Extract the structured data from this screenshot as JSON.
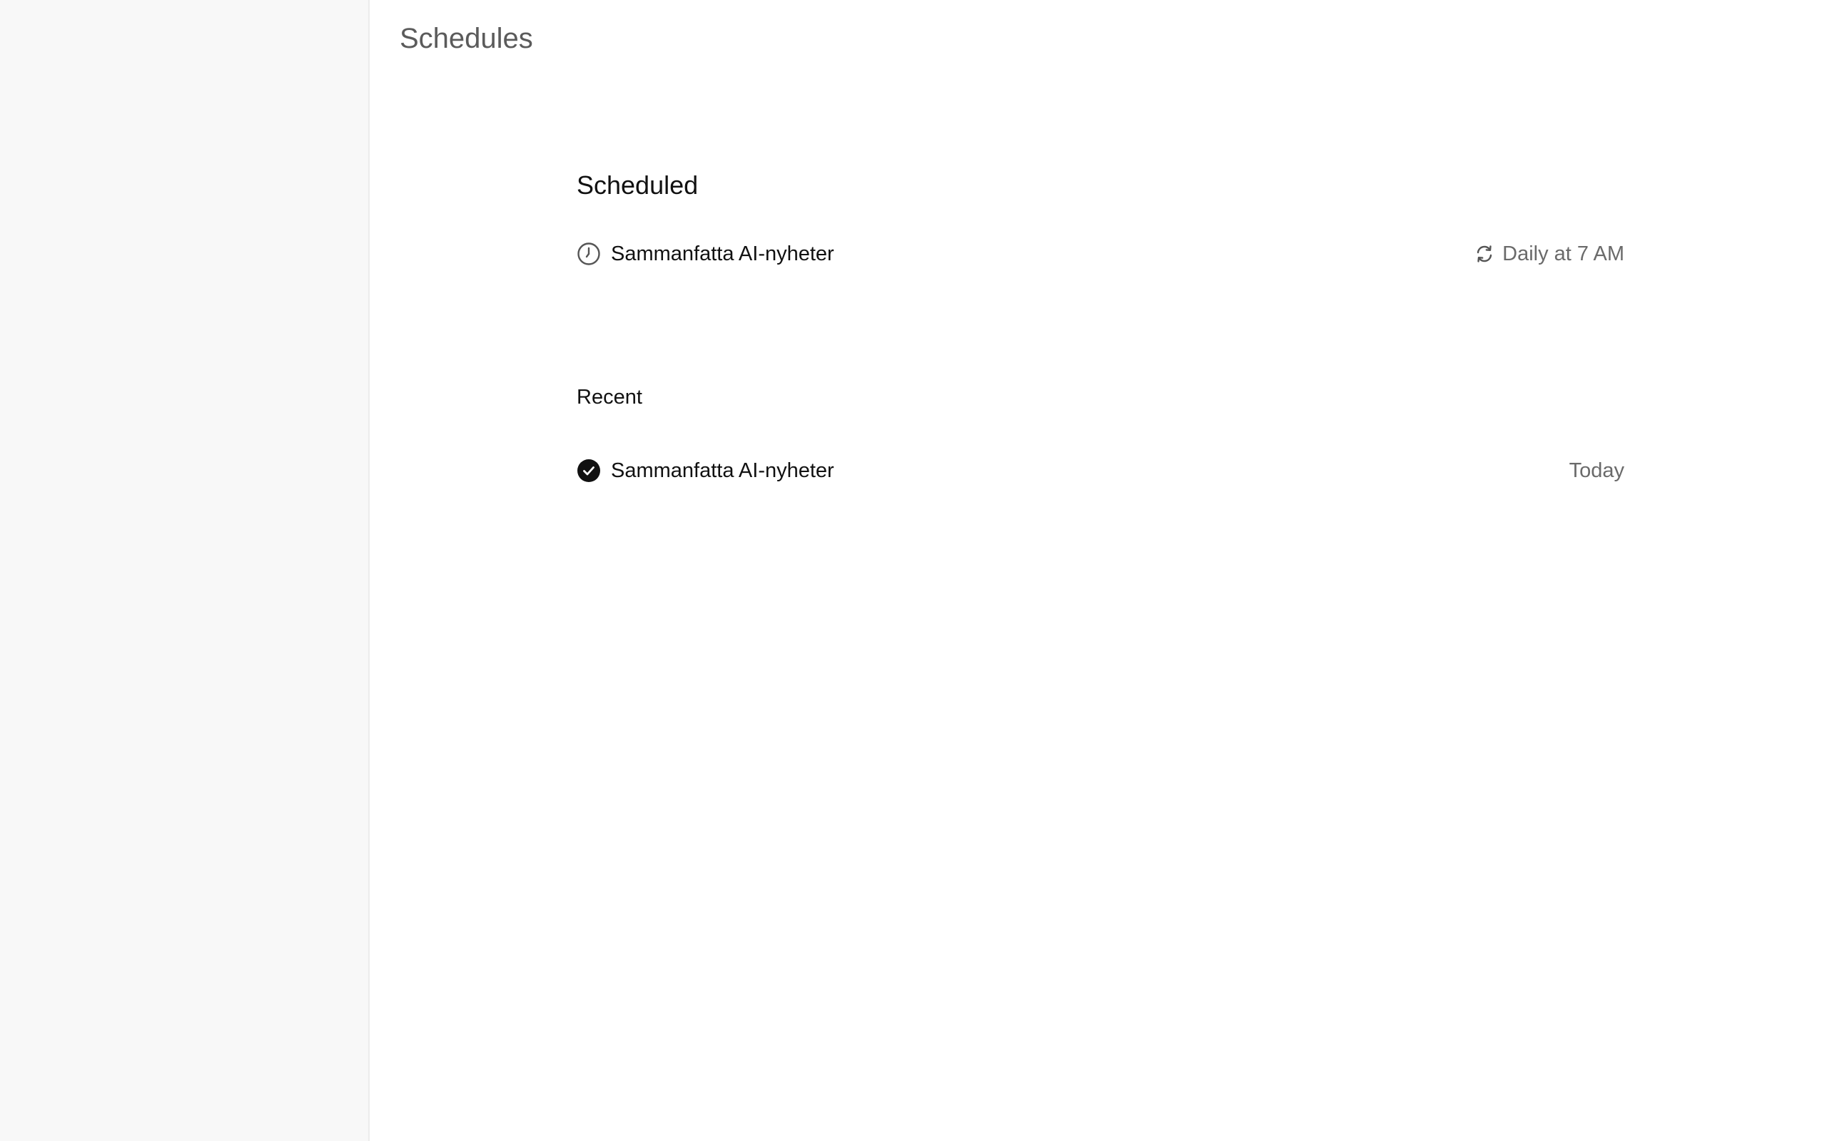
{
  "page": {
    "title": "Schedules"
  },
  "scheduled": {
    "heading": "Scheduled",
    "items": [
      {
        "name": "Sammanfatta AI-nyheter",
        "frequency": "Daily at 7 AM",
        "status_icon": "clock-icon",
        "frequency_icon": "repeat-icon"
      }
    ]
  },
  "recent": {
    "heading": "Recent",
    "items": [
      {
        "name": "Sammanfatta AI-nyheter",
        "when": "Today",
        "status_icon": "check-circle-icon"
      }
    ]
  },
  "colors": {
    "sidebar_bg": "#f8f8f8",
    "main_bg": "#ffffff",
    "title_text": "#5b5b5b",
    "primary_text": "#111111",
    "secondary_text": "#6a6a6a"
  }
}
